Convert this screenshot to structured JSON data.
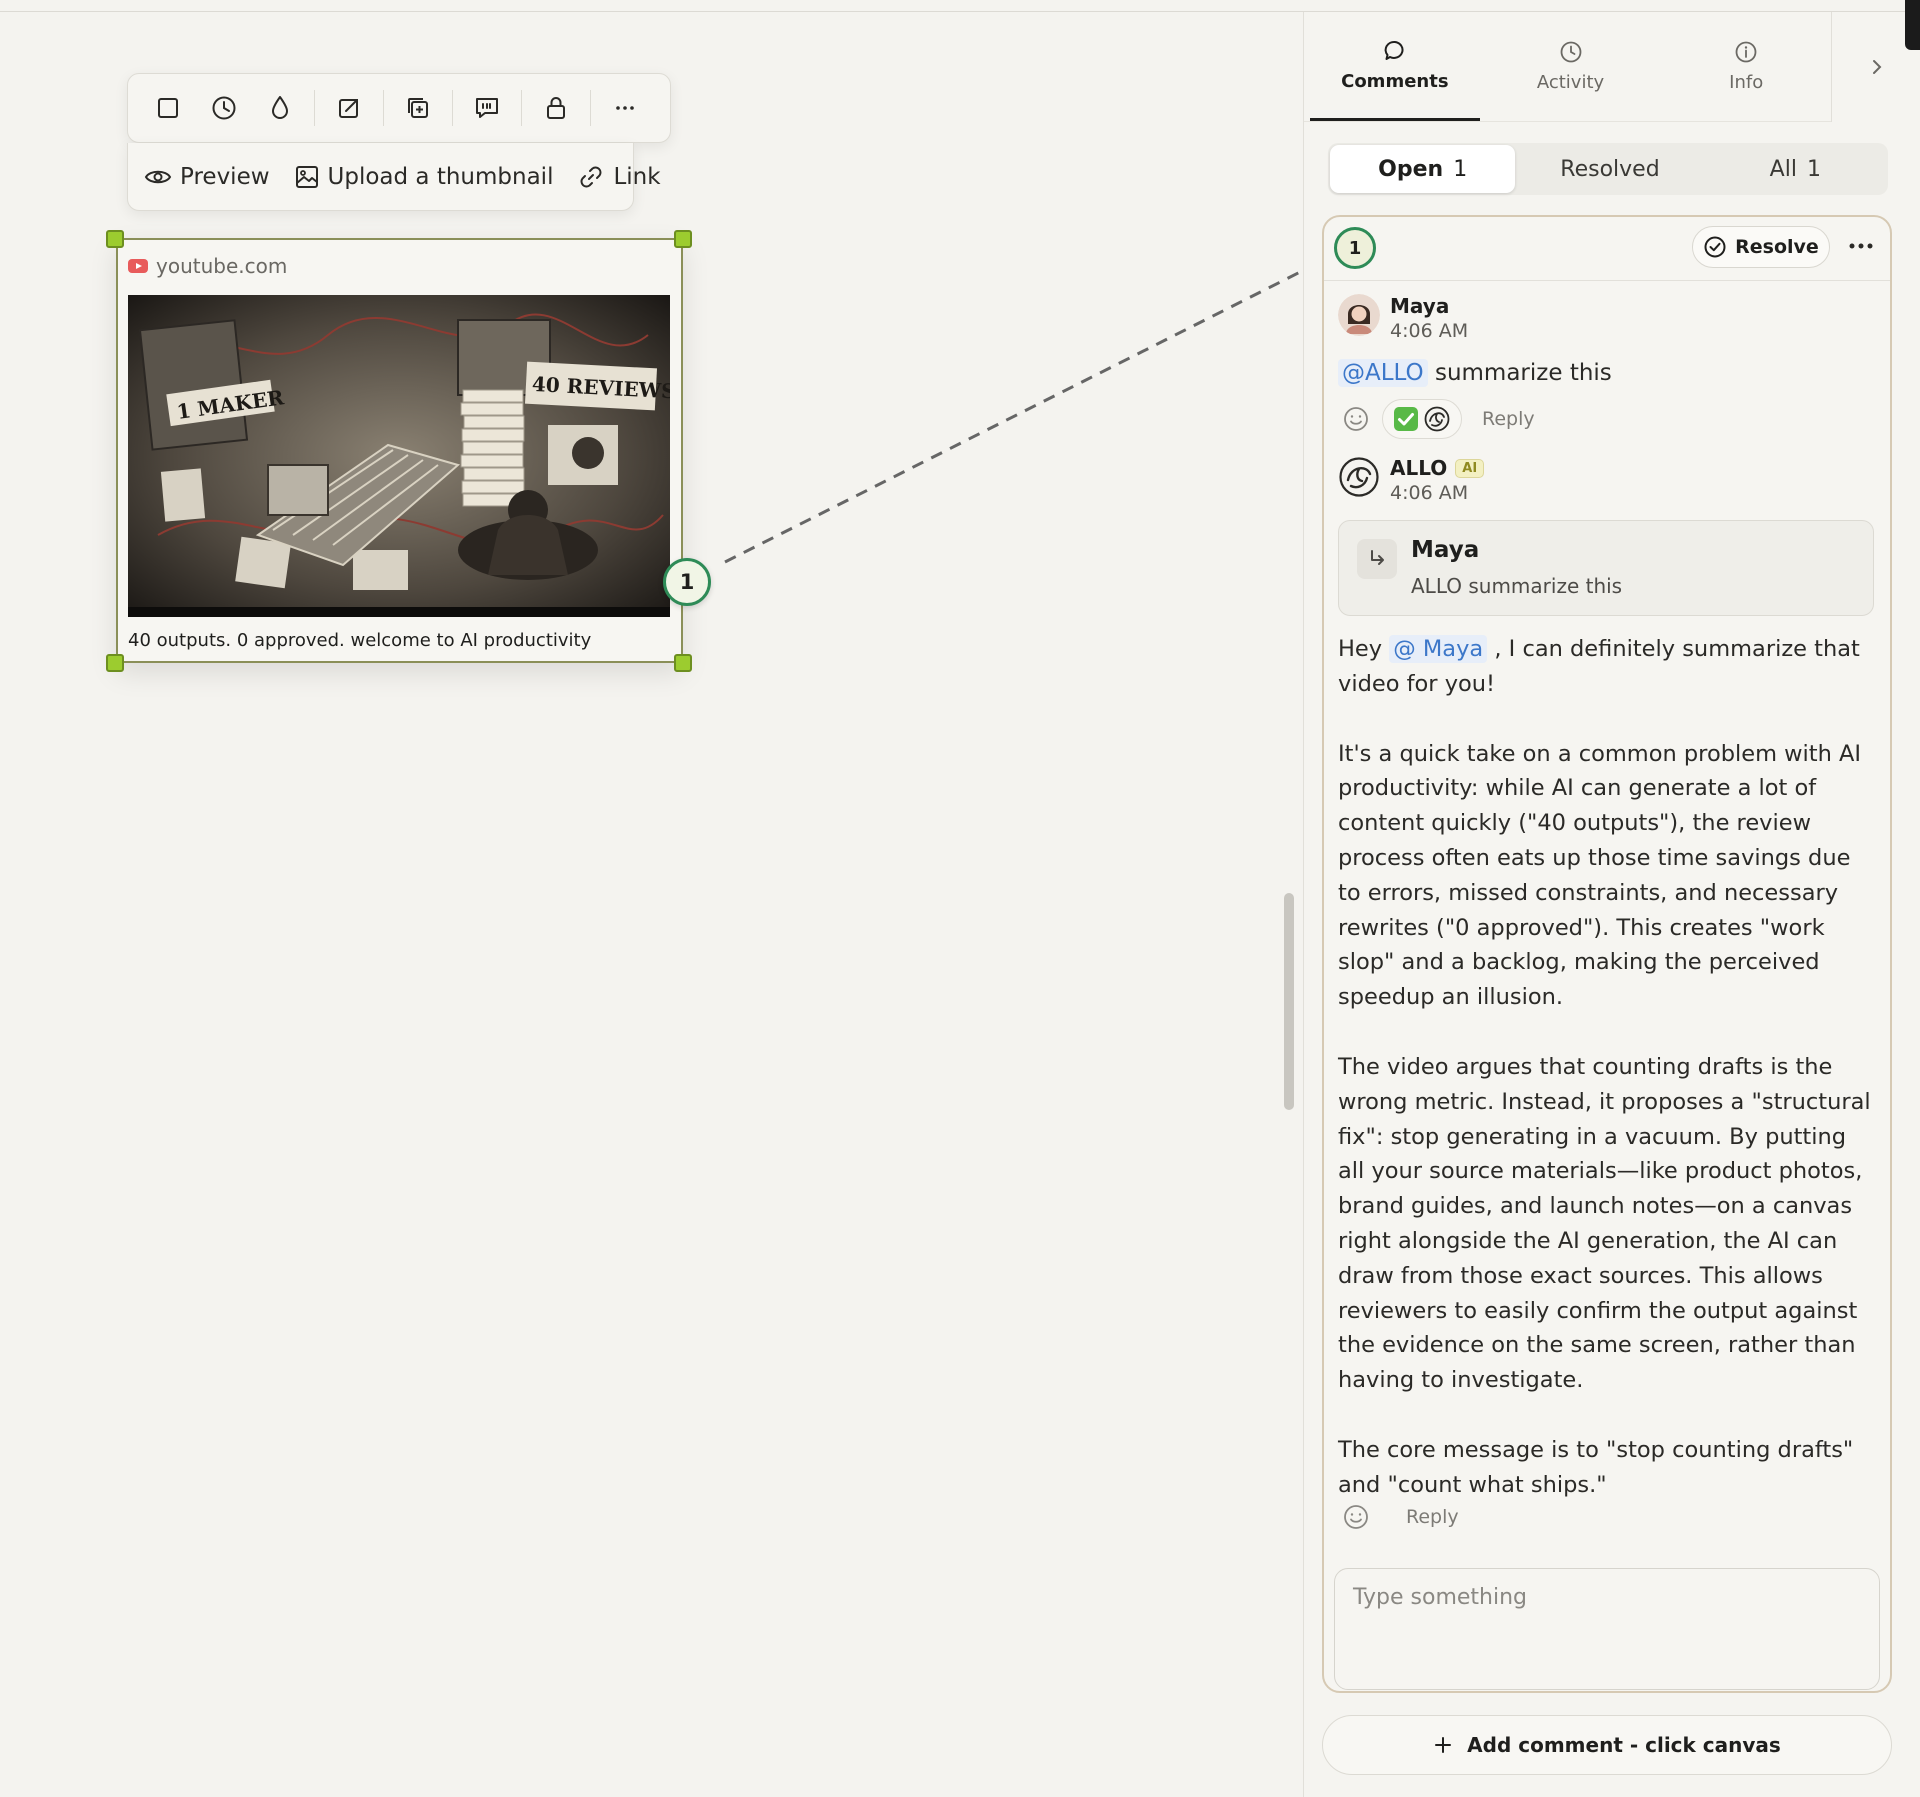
{
  "toolbar": {
    "row1_icons": [
      "frame-icon",
      "clock-icon",
      "drop-icon",
      "export-icon",
      "duplicate-icon",
      "comment-quote-icon",
      "lock-icon",
      "more-horizontal-icon"
    ],
    "preview_label": "Preview",
    "upload_label": "Upload a thumbnail",
    "link_label": "Link"
  },
  "card": {
    "source": "youtube.com",
    "caption": "40 outputs. 0 approved. welcome to AI productivity",
    "thumb_text_left": "1 MAKER",
    "thumb_text_right": "40 REVIEWS",
    "pin_number": "1"
  },
  "panel": {
    "tabs": [
      {
        "label": "Comments",
        "icon": "comment-icon"
      },
      {
        "label": "Activity",
        "icon": "clock-icon"
      },
      {
        "label": "Info",
        "icon": "info-icon"
      }
    ],
    "collapse_icon": "chevron-right-icon",
    "filters": {
      "open_label": "Open",
      "open_count": "1",
      "resolved_label": "Resolved",
      "all_label": "All",
      "all_count": "1"
    }
  },
  "thread": {
    "number": "1",
    "resolve_label": "Resolve",
    "message1": {
      "author": "Maya",
      "time": "4:06 AM",
      "mention": "@ALLO",
      "text": "summarize this",
      "reply_label": "Reply"
    },
    "message2": {
      "author": "ALLO",
      "badge": "AI",
      "time": "4:06 AM",
      "quote_author": "Maya",
      "quote_text": "ALLO summarize this",
      "greeting_prefix": "Hey",
      "mention": "@ Maya",
      "greeting_suffix": ", I can definitely summarize that video for you!",
      "paragraph2": "It's a quick take on a common problem with AI productivity: while AI can generate a lot of content quickly (\"40 outputs\"), the review process often eats up those time savings due to errors, missed constraints, and necessary rewrites (\"0 approved\"). This creates \"work slop\" and a backlog, making the perceived speedup an illusion.",
      "paragraph3": "The video argues that counting drafts is the wrong metric. Instead, it proposes a \"structural fix\": stop generating in a vacuum. By putting all your source materials—like product photos, brand guides, and launch notes—on a canvas right alongside the AI generation, the AI can draw from those exact sources. This allows reviewers to easily confirm the output against the evidence on the same screen, rather than having to investigate.",
      "paragraph4": "The core message is to \"stop counting drafts\" and \"count what ships.\"",
      "reply_label": "Reply"
    },
    "compose_placeholder": "Type something"
  },
  "add_comment_label": "Add comment - click canvas",
  "colors": {
    "background": "#f4f3ef",
    "selection": "#9ccc2f",
    "pin_border": "#2e8b57",
    "mention": "#3c77c9"
  }
}
